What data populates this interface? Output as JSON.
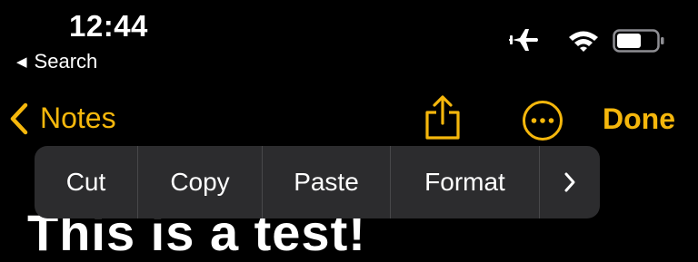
{
  "status_bar": {
    "time": "12:44",
    "back_app_label": "Search",
    "icons": [
      "airplane-mode-icon",
      "wifi-icon",
      "battery-icon"
    ]
  },
  "nav": {
    "back_label": "Notes",
    "done_label": "Done",
    "icons": [
      "chevron-left-icon",
      "share-icon",
      "more-icon"
    ]
  },
  "edit_menu": {
    "items": [
      "Cut",
      "Copy",
      "Paste",
      "Format"
    ],
    "more_icon": "chevron-right-icon"
  },
  "note": {
    "visible_text": "This is a test!"
  },
  "colors": {
    "accent": "#f5b70c",
    "background": "#000000",
    "menu_background": "#2c2c2e",
    "menu_divider": "#48484a"
  }
}
